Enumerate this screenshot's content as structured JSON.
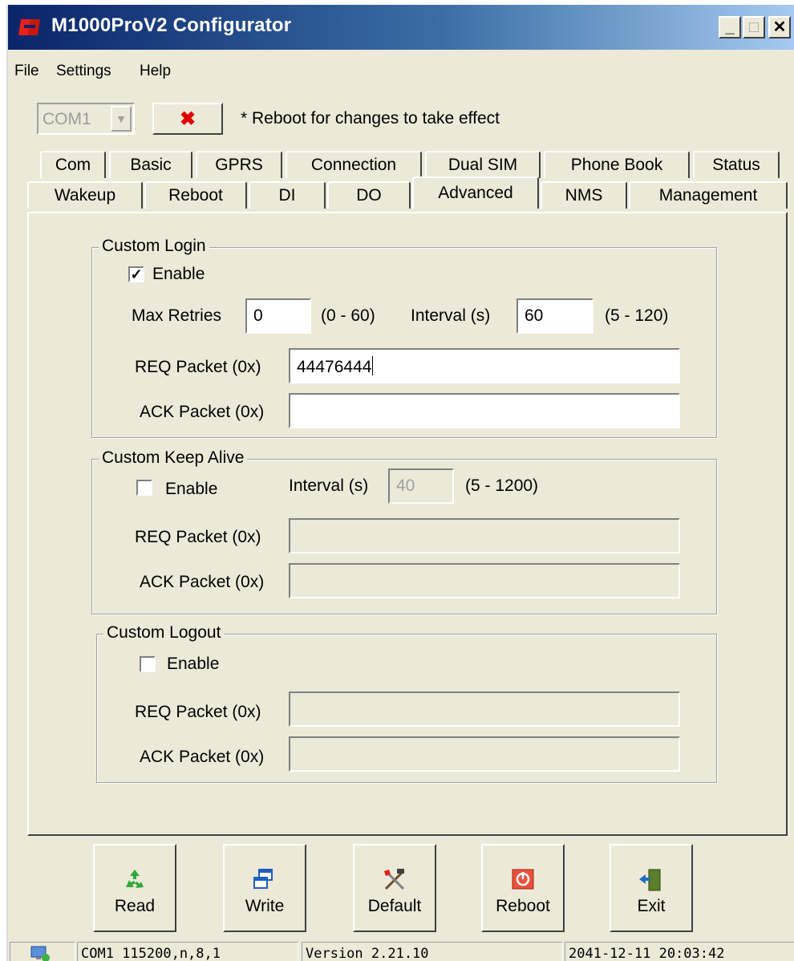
{
  "window": {
    "title": "M1000ProV2 Configurator"
  },
  "menu": [
    "File",
    "Settings",
    "Help"
  ],
  "com": {
    "port": "COM1",
    "note": "* Reboot for changes to take effect"
  },
  "tabs_row1": [
    "Com",
    "Basic",
    "GPRS",
    "Connection",
    "Dual SIM",
    "Phone Book",
    "Status"
  ],
  "tabs_row2": [
    "Wakeup",
    "Reboot",
    "DI",
    "DO",
    "Advanced",
    "NMS",
    "Management"
  ],
  "active_tab": "Advanced",
  "login": {
    "title": "Custom Login",
    "enable_label": "Enable",
    "enabled": true,
    "max_retries_label": "Max Retries",
    "max_retries": "0",
    "max_retries_range": "(0 - 60)",
    "interval_label": "Interval (s)",
    "interval": "60",
    "interval_range": "(5 - 120)",
    "req_label": "REQ Packet (0x)",
    "req": "44476444",
    "ack_label": "ACK Packet (0x)",
    "ack": ""
  },
  "keepalive": {
    "title": "Custom Keep Alive",
    "enable_label": "Enable",
    "enabled": false,
    "interval_label": "Interval (s)",
    "interval": "40",
    "interval_range": "(5 - 1200)",
    "req_label": "REQ Packet (0x)",
    "req": "",
    "ack_label": "ACK Packet (0x)",
    "ack": ""
  },
  "logout": {
    "title": "Custom Logout",
    "enable_label": "Enable",
    "enabled": false,
    "req_label": "REQ Packet (0x)",
    "req": "",
    "ack_label": "ACK Packet (0x)",
    "ack": ""
  },
  "buttons": {
    "read": "Read",
    "write": "Write",
    "default": "Default",
    "reboot": "Reboot",
    "exit": "Exit"
  },
  "status": {
    "port_settings": "COM1 115200,n,8,1",
    "version": "Version 2.21.10",
    "datetime": "2041-12-11 20:03:42"
  },
  "colors": {
    "face": "#ece9d8",
    "title_start": "#0a246a",
    "title_end": "#a6caf0",
    "close_x": "#e00000"
  }
}
